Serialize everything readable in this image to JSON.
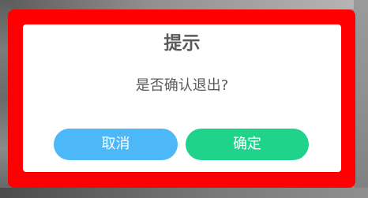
{
  "dialog": {
    "title": "提示",
    "message": "是否确认退出?",
    "cancel_label": "取消",
    "confirm_label": "确定"
  },
  "colors": {
    "highlight_frame": "#ff0000",
    "dialog_background": "#ffffff",
    "text": "#5a5a5a",
    "cancel_button": "#4cb8f7",
    "confirm_button": "#1fd38b"
  }
}
